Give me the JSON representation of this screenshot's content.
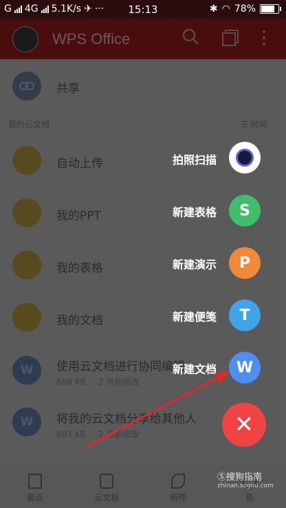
{
  "status_bar": {
    "carrier_left": "G",
    "network": "4G",
    "speed": "5.1K/s",
    "dots": "···",
    "time": "15:13",
    "battery": "78%"
  },
  "app_bar": {
    "title": "WPS Office",
    "search_icon": "search-icon",
    "tabs_icon": "tabs-icon",
    "more_icon": "more-vertical-icon"
  },
  "share_row": {
    "label": "共享"
  },
  "section": {
    "title": "我的云文档",
    "sort_label": "时间"
  },
  "rows": [
    {
      "title": "自动上传",
      "subtitle": ""
    },
    {
      "title": "我的PPT",
      "subtitle": ""
    },
    {
      "title": "我的表格",
      "subtitle": ""
    },
    {
      "title": "我的文档",
      "subtitle": ""
    },
    {
      "title": "使用云文档进行协同编辑",
      "size": "608 KB",
      "date": "2 月前修改"
    },
    {
      "title": "将我的云文档分享给其他人",
      "size": "603 KB",
      "date": "2 月前修改"
    }
  ],
  "fab_menu": [
    {
      "label": "拍照扫描",
      "letter": "",
      "color": "#ffffff",
      "icon": "camera-icon"
    },
    {
      "label": "新建表格",
      "letter": "S",
      "color": "#3fbf6b",
      "icon": "spreadsheet-icon"
    },
    {
      "label": "新建演示",
      "letter": "P",
      "color": "#f08a3a",
      "icon": "presentation-icon"
    },
    {
      "label": "新建便笺",
      "letter": "T",
      "color": "#3ea6e8",
      "icon": "note-icon"
    },
    {
      "label": "新建文档",
      "letter": "W",
      "color": "#4c8ff0",
      "icon": "document-icon"
    }
  ],
  "main_fab": {
    "symbol": "✕",
    "color": "#f24343"
  },
  "bottom_nav": [
    {
      "label": "最近"
    },
    {
      "label": "云文档"
    },
    {
      "label": "稻壳"
    },
    {
      "label": "我"
    }
  ],
  "watermark": {
    "brand": "搜狗指南",
    "url": "zhinan.sogou.com"
  }
}
